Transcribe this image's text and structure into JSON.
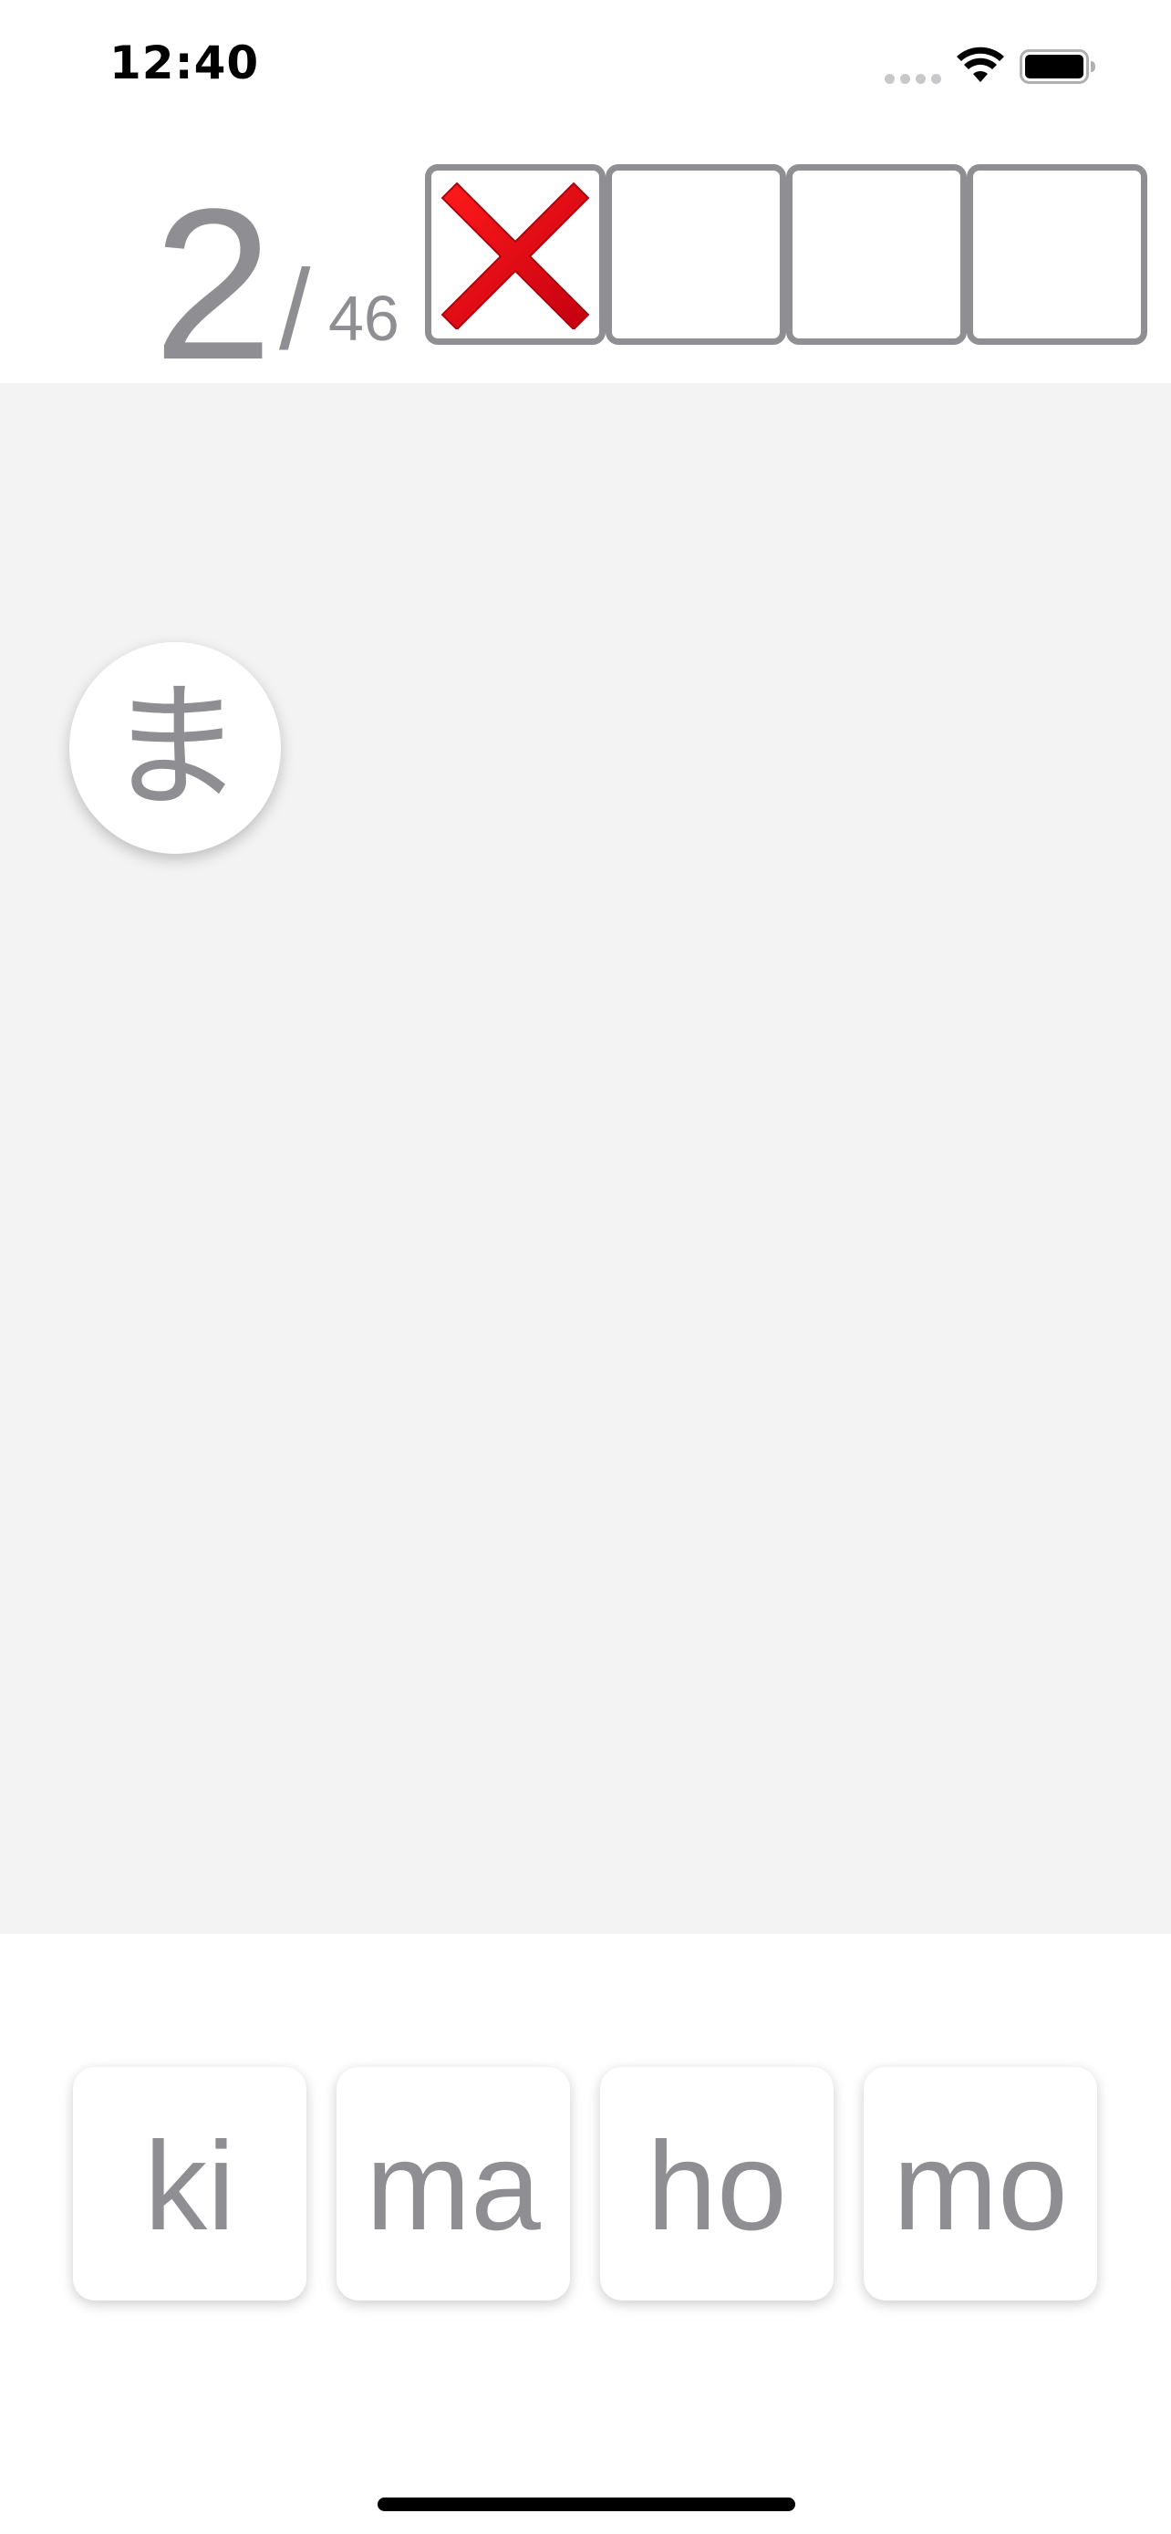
{
  "status_bar": {
    "time": "12:40"
  },
  "header": {
    "current": "2",
    "separator": "/",
    "total": "46",
    "attempts": [
      {
        "state": "wrong"
      },
      {
        "state": "empty"
      },
      {
        "state": "empty"
      },
      {
        "state": "empty"
      }
    ]
  },
  "question": {
    "kana": "ま"
  },
  "answers": [
    {
      "label": "ki"
    },
    {
      "label": "ma"
    },
    {
      "label": "ho"
    },
    {
      "label": "mo"
    }
  ],
  "colors": {
    "text_gray": "#8e8e93",
    "wrong_red": "#e3000f",
    "play_area_bg": "#f3f3f3"
  },
  "icons": {
    "wrong": "cross-mark-icon",
    "wifi": "wifi-icon",
    "battery": "battery-icon",
    "signal": "cellular-signal-icon"
  }
}
